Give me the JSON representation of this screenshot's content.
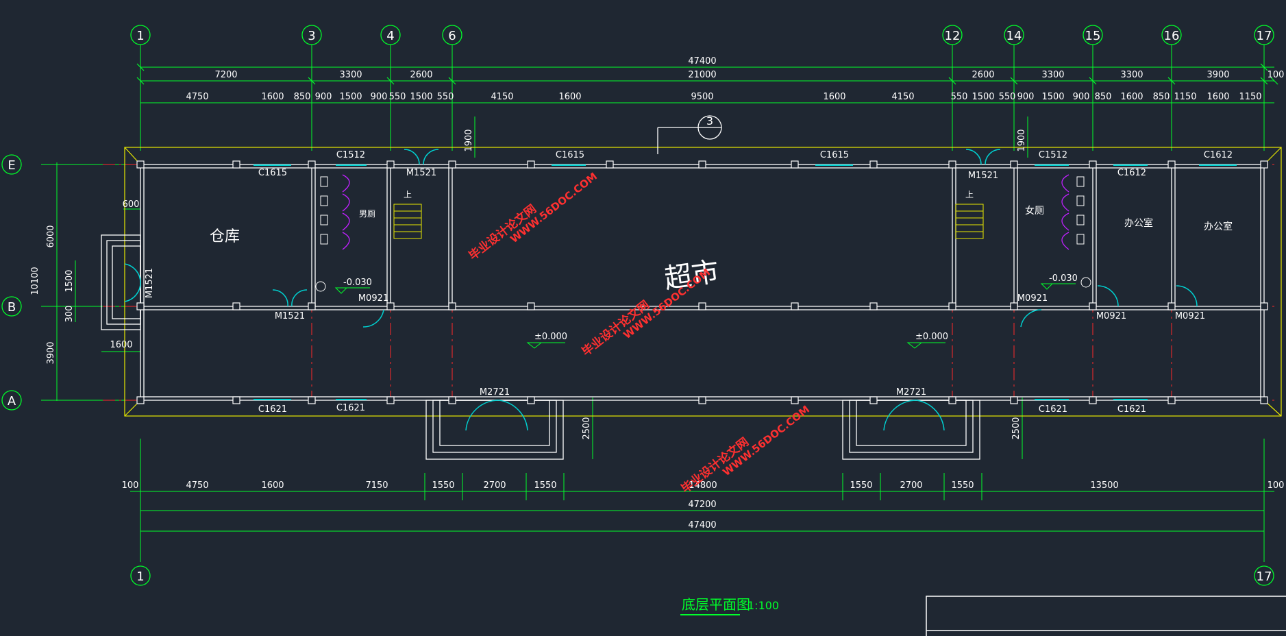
{
  "drawing": {
    "title": "底层平面图",
    "scale": "1:100",
    "colors": {
      "background": "#1f2732",
      "dimension": "#00ff2a",
      "wall": "#ffffff",
      "axis": "#ff2a2a",
      "outline": "#e8e800",
      "door": "#00d0d0",
      "fixture": "#c020ff",
      "watermark": "#ff3030"
    }
  },
  "grid": {
    "columns_top": [
      "1",
      "3",
      "4",
      "6",
      "12",
      "14",
      "15",
      "16",
      "17"
    ],
    "columns_bottom": [
      "1",
      "17"
    ],
    "rows": [
      "E",
      "B",
      "A"
    ]
  },
  "dims": {
    "top1": [
      "7200",
      "3300",
      "2600",
      "21000",
      "2600",
      "3300",
      "3300",
      "3900",
      "100"
    ],
    "top_total": "47400",
    "top2": [
      "4750",
      "1600",
      "850",
      "900",
      "1500",
      "900",
      "550",
      "1500",
      "550",
      "4150",
      "1600",
      "9500",
      "1600",
      "4150",
      "550",
      "1500",
      "550",
      "900",
      "1500",
      "900",
      "850",
      "1600",
      "850",
      "1150",
      "1600",
      "1150"
    ],
    "left": [
      "6000",
      "1500",
      "300",
      "3900",
      "10100",
      "600",
      "1600"
    ],
    "bottom1": [
      "100",
      "4750",
      "1600",
      "7150",
      "1550",
      "2700",
      "1550",
      "14800",
      "1550",
      "2700",
      "1550",
      "13500",
      "100"
    ],
    "bottom_total1": "47200",
    "bottom_total2": "47400",
    "vertical": [
      "1900",
      "1900",
      "2500",
      "2500"
    ]
  },
  "rooms": {
    "warehouse": "仓库",
    "mens_wc": "男厕",
    "womens_wc": "女厕",
    "office1": "办公室",
    "office2": "办公室",
    "supermarket": "超市",
    "stair_up_1": "上",
    "stair_up_2": "上"
  },
  "levels": [
    "-0.030",
    "-0.030",
    "±0.000",
    "±0.000"
  ],
  "openings": {
    "windows_top": [
      "C1615",
      "C1512",
      "C1615",
      "C1615",
      "C1512",
      "C1612",
      "C1612"
    ],
    "windows_bottom": [
      "C1621",
      "C1621",
      "C1621",
      "C1621"
    ],
    "doors": [
      "M1521",
      "M1521",
      "M1521",
      "M0921",
      "M0921",
      "M0921",
      "M0921",
      "M2721",
      "M2721",
      "M1521"
    ]
  },
  "section_mark": "3",
  "watermarks": [
    {
      "cn": "毕业设计论文网",
      "en": "WWW.56DOC.COM"
    },
    {
      "cn": "毕业设计论文网",
      "en": "WWW.56DOC.COM"
    },
    {
      "cn": "毕业设计论文网",
      "en": "WWW.56DOC.COM"
    }
  ]
}
